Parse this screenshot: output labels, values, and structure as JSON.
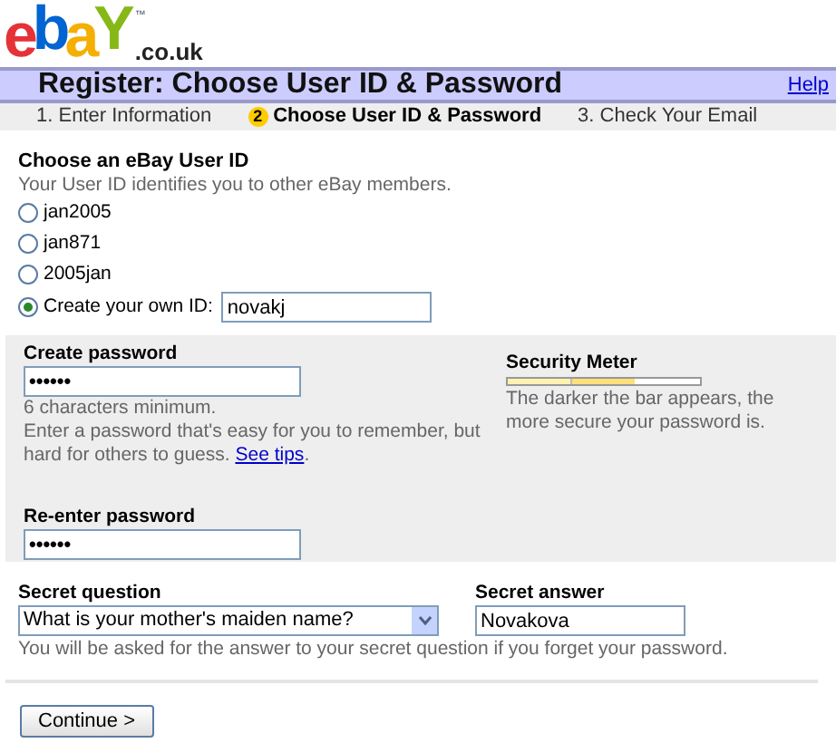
{
  "logo": {
    "letters": [
      {
        "text": "e",
        "color": "#e53238"
      },
      {
        "text": "b",
        "color": "#0064d2"
      },
      {
        "text": "a",
        "color": "#f5af02"
      },
      {
        "text": "Y",
        "color": "#86b817"
      }
    ],
    "mark": "™",
    "domain": ".co.uk"
  },
  "header": {
    "title": "Register: Choose User ID & Password",
    "help": "Help"
  },
  "steps": [
    {
      "number": "1.",
      "label": "Enter Information",
      "selected": false
    },
    {
      "number": "2",
      "label": "Choose User ID & Password",
      "selected": true
    },
    {
      "number": "3.",
      "label": "Check Your Email",
      "selected": false
    }
  ],
  "user_id": {
    "heading": "Choose an eBay User ID",
    "hint": "Your User ID identifies you to other eBay members.",
    "options": [
      {
        "label": "jan2005",
        "selected": false
      },
      {
        "label": "jan871",
        "selected": false
      },
      {
        "label": "2005jan",
        "selected": false
      },
      {
        "label": "Create your own ID:",
        "selected": true,
        "value": "novakj"
      }
    ]
  },
  "password": {
    "label": "Create password",
    "value": "••••••",
    "note": "6 characters minimum.",
    "help": "Enter a password that's easy for you to remember, but hard for others to guess. ",
    "link": "See tips",
    "link_after": ".",
    "confirm_label": "Re-enter password",
    "confirm_value": "••••••"
  },
  "security_meter": {
    "label": "Security Meter",
    "level": 0.66,
    "hint": "The darker the bar appears, the more secure your password is."
  },
  "secret": {
    "question_label": "Secret question",
    "question": "What is your mother's maiden name?",
    "answer_label": "Secret answer",
    "answer": "Novakova",
    "hint": "You will be asked for the answer to your secret question if you forget your password."
  },
  "buttons": [
    "Continue >"
  ]
}
